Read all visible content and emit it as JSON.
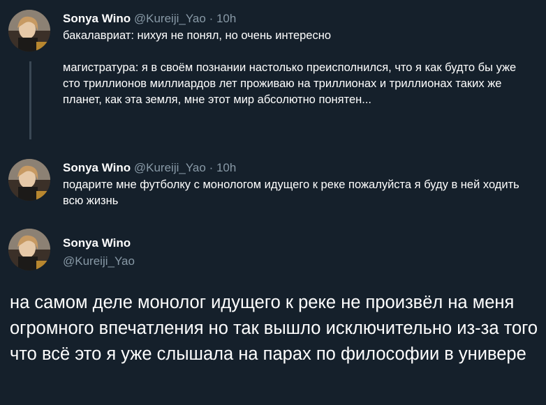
{
  "tweets": [
    {
      "name": "Sonya Wino",
      "handle": "@Kureiji_Yao",
      "separator": "·",
      "time": "10h",
      "paragraphs": [
        "бакалавриат: нихуя не понял, но очень интересно",
        "магистратура: я в своём познании настолько преисполнился, что я как будто бы уже сто триллионов миллиардов лет проживаю на триллионах и триллионах таких же планет, как эта земля, мне этот мир абсолютно понятен..."
      ]
    },
    {
      "name": "Sonya Wino",
      "handle": "@Kureiji_Yao",
      "separator": "·",
      "time": "10h",
      "paragraphs": [
        "подарите мне футболку с монологом идущего к реке пожалуйста я буду в ней ходить всю жизнь"
      ]
    }
  ],
  "main_tweet": {
    "name": "Sonya Wino",
    "handle": "@Kureiji_Yao",
    "text": "на самом деле монолог идущего к реке не произвёл на меня огромного впечатления но так вышло исключительно из-за того что всё это я уже слышала на парах по философии в универе"
  },
  "colors": {
    "background": "#15202b",
    "text": "#ffffff",
    "secondary": "#8899a6",
    "thread_line": "#3a4754"
  }
}
